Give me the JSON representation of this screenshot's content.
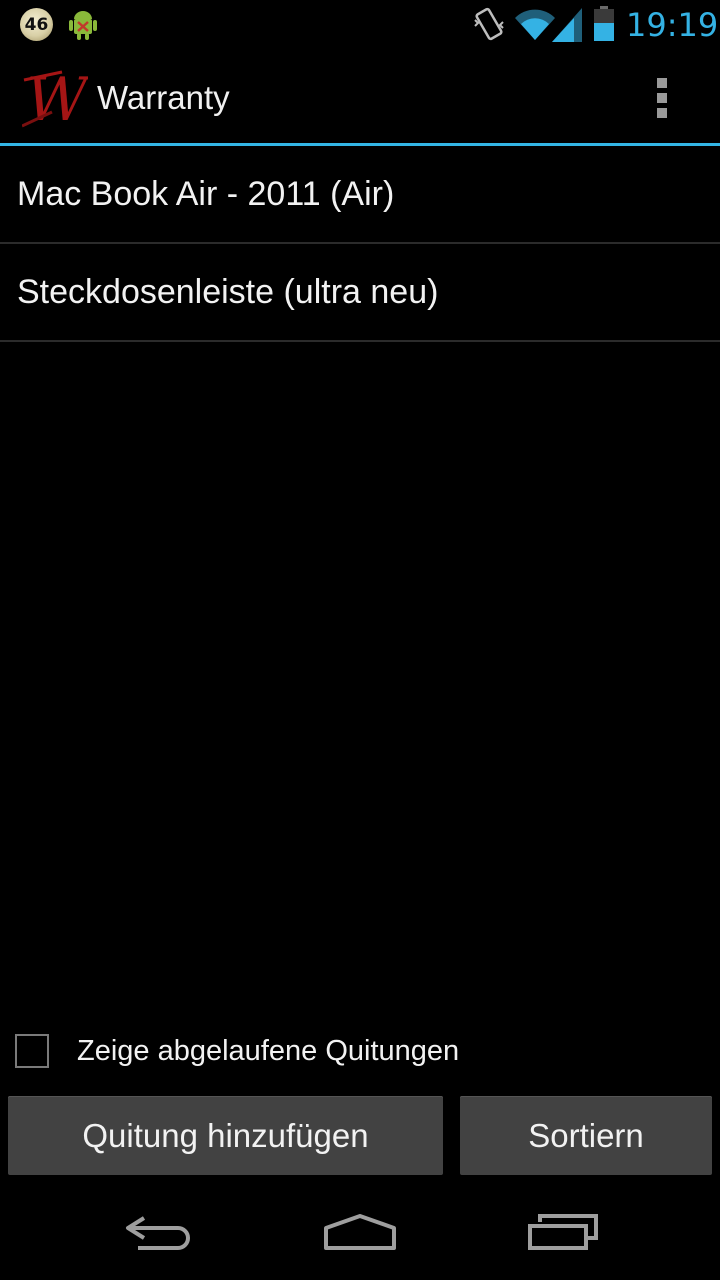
{
  "status_bar": {
    "badge_count": "46",
    "time": "19:19",
    "icons": [
      "badge-icon",
      "android-icon",
      "vibrate-icon",
      "wifi-icon",
      "signal-icon",
      "battery-icon"
    ],
    "time_color": "#34b2e4"
  },
  "action_bar": {
    "title": "Warranty",
    "logo_letter": "W",
    "accent_color": "#33b5e5"
  },
  "list": {
    "items": [
      {
        "label": "Mac Book Air - 2011 (Air)"
      },
      {
        "label": "Steckdosenleiste (ultra neu)"
      }
    ]
  },
  "footer": {
    "show_expired_label": "Zeige abgelaufene Quitungen",
    "show_expired_checked": false,
    "add_button_label": "Quitung hinzufügen",
    "sort_button_label": "Sortiern"
  },
  "nav_bar": {
    "icons": [
      "back-icon",
      "home-icon",
      "recent-apps-icon"
    ]
  }
}
